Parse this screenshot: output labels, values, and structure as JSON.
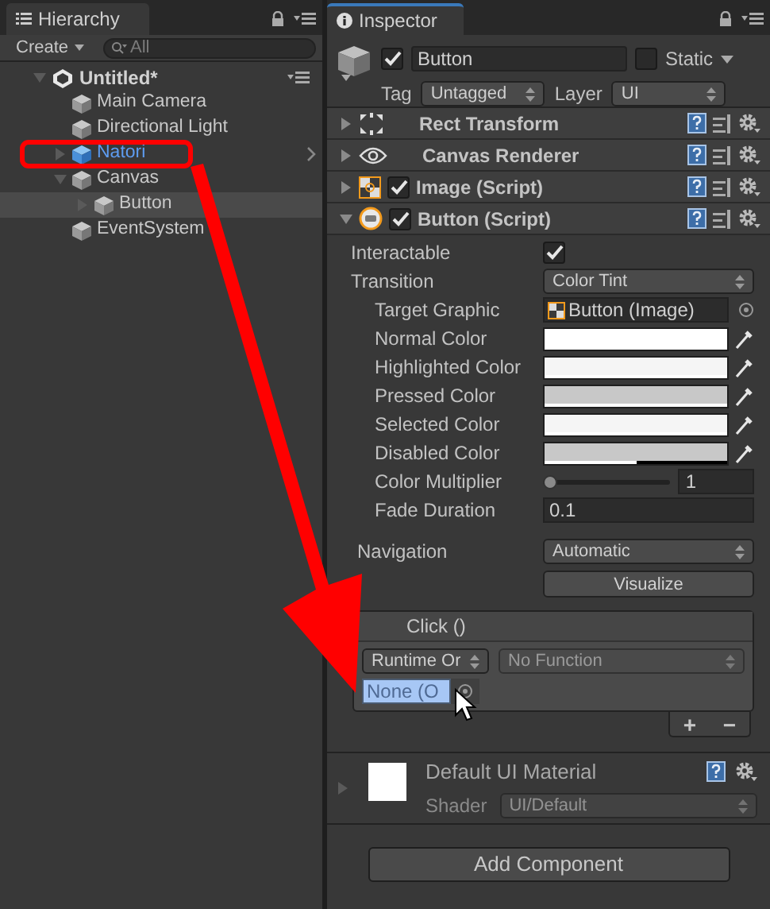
{
  "hierarchy": {
    "tab": "Hierarchy",
    "create": "Create",
    "search_placeholder": "All",
    "scene": {
      "name": "Untitled*",
      "expanded": true
    },
    "items": [
      {
        "name": "Main Camera",
        "kind": "object",
        "selected": false
      },
      {
        "name": "Directional Light",
        "kind": "object",
        "selected": false
      },
      {
        "name": "Natori",
        "kind": "prefab",
        "selected": false,
        "expanded": false
      },
      {
        "name": "Canvas",
        "kind": "object",
        "selected": false,
        "expanded": true,
        "children": [
          {
            "name": "Button",
            "kind": "object",
            "selected": true,
            "expanded": false
          }
        ]
      },
      {
        "name": "EventSystem",
        "kind": "object",
        "selected": false
      }
    ]
  },
  "inspector": {
    "tab": "Inspector",
    "object": {
      "active": true,
      "name": "Button",
      "static": false,
      "static_label": "Static",
      "tag_label": "Tag",
      "tag": "Untagged",
      "layer_label": "Layer",
      "layer": "UI"
    },
    "components": [
      {
        "name": "Rect Transform",
        "kind": "transform",
        "expanded": false
      },
      {
        "name": "Canvas Renderer",
        "kind": "renderer",
        "expanded": false
      },
      {
        "name": "Image (Script)",
        "kind": "image",
        "enabled": true,
        "expanded": false
      },
      {
        "name": "Button (Script)",
        "kind": "button",
        "enabled": true,
        "expanded": true
      }
    ],
    "properties": [
      {
        "label": "Interactable",
        "kind": "checkbox",
        "checked": true
      },
      {
        "label": "Transition",
        "kind": "dropdown",
        "value": "Color Tint"
      },
      {
        "label": "Target Graphic",
        "kind": "object",
        "value": "Button (Image)"
      },
      {
        "label": "Normal Color",
        "kind": "color",
        "color": "#ffffff",
        "level": 1
      },
      {
        "label": "Highlighted Color",
        "kind": "color",
        "color": "#f5f5f5",
        "level": 1
      },
      {
        "label": "Pressed Color",
        "kind": "color",
        "color": "#c8c8c8",
        "level": 1
      },
      {
        "label": "Selected Color",
        "kind": "color",
        "color": "#f5f5f5",
        "level": 1
      },
      {
        "label": "Disabled Color",
        "kind": "color",
        "color": "#c8c8c8",
        "level": 0.5
      },
      {
        "label": "Color Multiplier",
        "kind": "slider",
        "level": 0,
        "value": "1"
      },
      {
        "label": "Fade Duration",
        "kind": "text",
        "value": "0.1"
      }
    ],
    "navigation": {
      "label": "Navigation",
      "value": "Automatic",
      "button": "Visualize"
    },
    "on_click": {
      "title": "Click ()",
      "runtime": "Runtime Or",
      "function": "No Function",
      "target": "None (O",
      "add": "+",
      "remove": "−"
    },
    "material": {
      "name": "Default UI Material",
      "shader_label": "Shader",
      "shader": "UI/Default"
    },
    "add_component": "Add Component"
  }
}
